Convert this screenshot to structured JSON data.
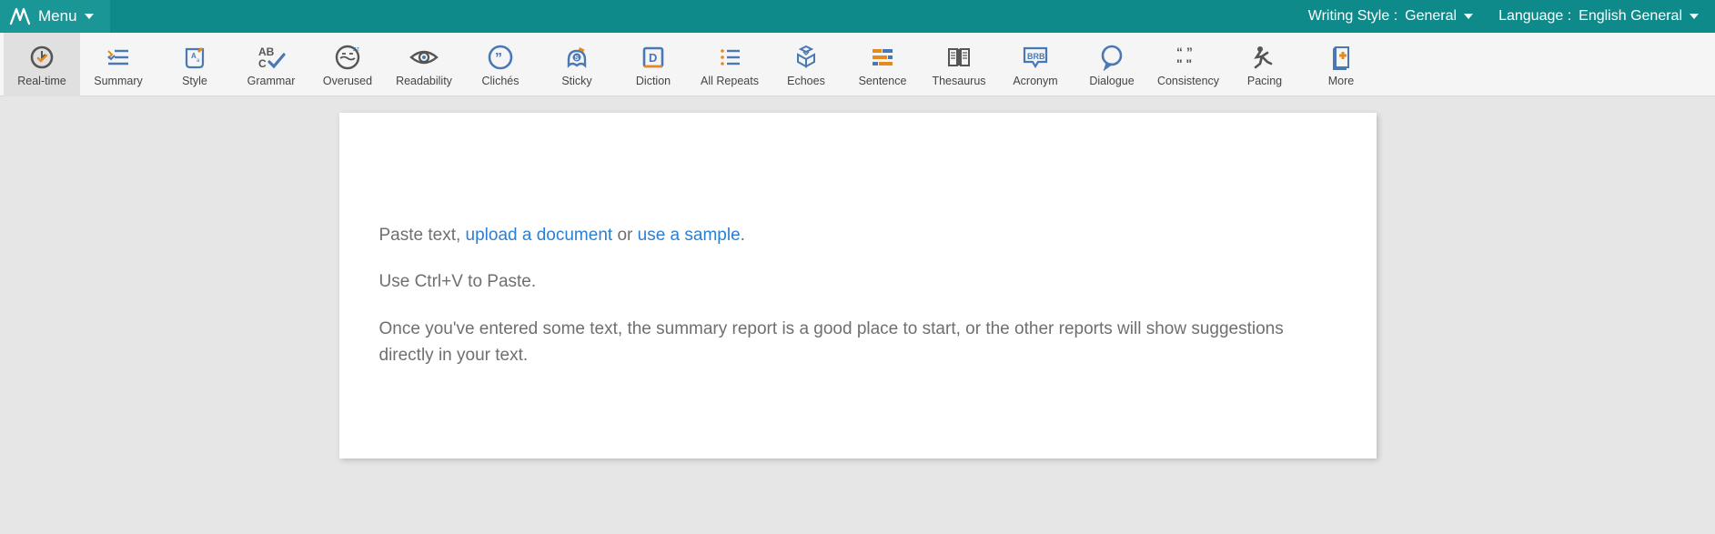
{
  "header": {
    "menu_label": "Menu",
    "writing_style_label": "Writing Style :",
    "writing_style_value": "General",
    "language_label": "Language :",
    "language_value": "English General"
  },
  "toolbar": {
    "realtime": "Real-time",
    "summary": "Summary",
    "style": "Style",
    "grammar": "Grammar",
    "overused": "Overused",
    "readability": "Readability",
    "cliches": "Clichés",
    "sticky": "Sticky",
    "diction": "Diction",
    "all_repeats": "All Repeats",
    "echoes": "Echoes",
    "sentence": "Sentence",
    "thesaurus": "Thesaurus",
    "acronym": "Acronym",
    "dialogue": "Dialogue",
    "consistency": "Consistency",
    "pacing": "Pacing",
    "more": "More"
  },
  "editor": {
    "line1_prefix": "Paste text, ",
    "line1_link1": "upload a document",
    "line1_mid": " or ",
    "line1_link2": "use a sample",
    "line1_suffix": ".",
    "line2": "Use Ctrl+V to Paste.",
    "line3": "Once you've entered some text, the summary report is a good place to start, or the other reports will show suggestions directly in your text."
  }
}
